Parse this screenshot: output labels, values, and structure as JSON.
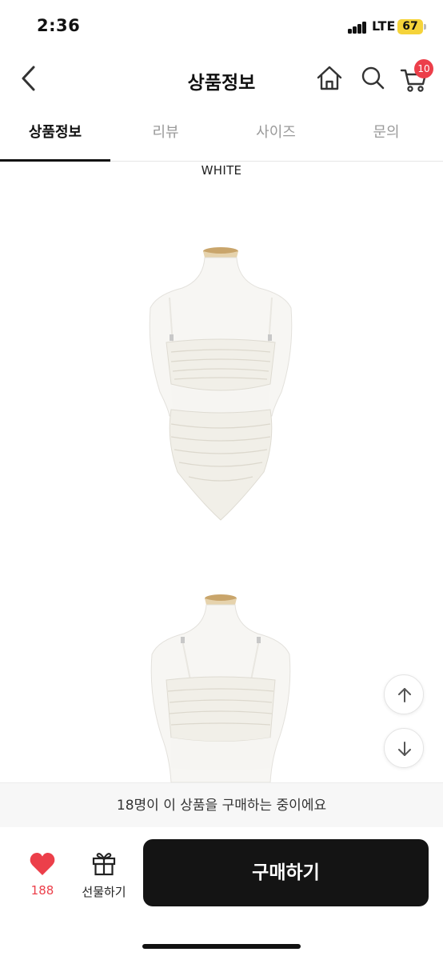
{
  "status_bar": {
    "time": "2:36",
    "network": "LTE",
    "battery": "67"
  },
  "header": {
    "title": "상품정보",
    "cart_count": "10",
    "icons": {
      "back": "chevron-left-icon",
      "home": "home-icon",
      "search": "search-icon",
      "cart": "cart-icon"
    }
  },
  "tabs": [
    {
      "label": "상품정보",
      "active": true
    },
    {
      "label": "리뷰",
      "active": false
    },
    {
      "label": "사이즈",
      "active": false
    },
    {
      "label": "문의",
      "active": false
    }
  ],
  "content": {
    "color_label": "WHITE",
    "images": [
      "front-view",
      "back-view"
    ],
    "product_color": "#f1efe8"
  },
  "notice": {
    "text": "18명이 이 상품을 구매하는 중이에요"
  },
  "actions": {
    "like_count": "188",
    "gift_label": "선물하기",
    "buy_label": "구매하기"
  },
  "colors": {
    "accent": "#ec3f4a",
    "buy_button": "#141414",
    "battery": "#f5d33a"
  }
}
